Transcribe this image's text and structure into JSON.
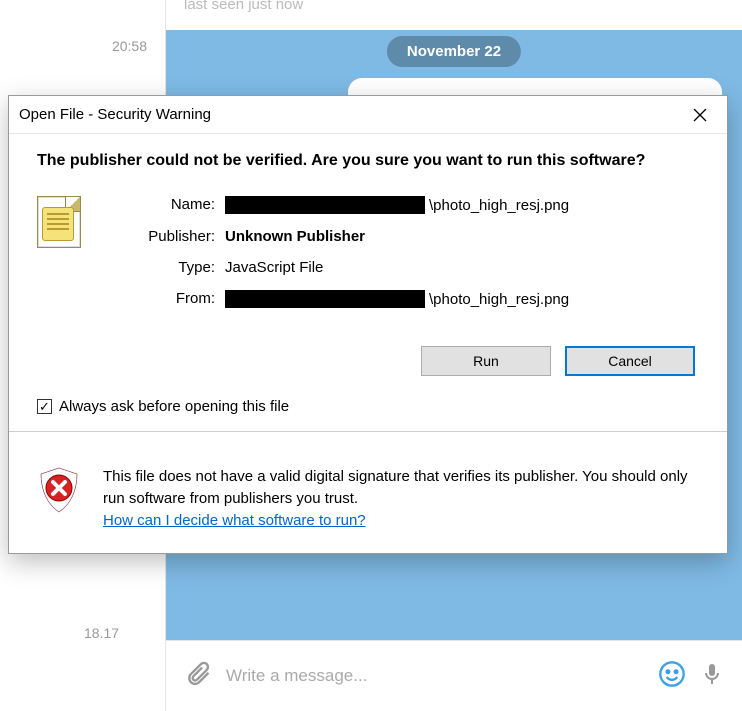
{
  "background": {
    "topbar_text": "last seen just now",
    "time1": "20:58",
    "time2": "18.17",
    "date_pill": "November 22",
    "message_placeholder": "Write a message..."
  },
  "dialog": {
    "title": "Open File - Security Warning",
    "heading": "The publisher could not be verified.  Are you sure you want to run this software?",
    "labels": {
      "name": "Name:",
      "publisher": "Publisher:",
      "type": "Type:",
      "from": "From:"
    },
    "values": {
      "name_suffix": "\\photo_high_resj.png",
      "publisher": "Unknown Publisher",
      "type": "JavaScript File",
      "from_suffix": "\\photo_high_resj.png"
    },
    "buttons": {
      "run": "Run",
      "cancel": "Cancel"
    },
    "checkbox": {
      "checked": true,
      "label": "Always ask before opening this file"
    },
    "footer": {
      "text": "This file does not have a valid digital signature that verifies its publisher.  You should only run software from publishers you trust.",
      "link": "How can I decide what software to run?"
    }
  }
}
